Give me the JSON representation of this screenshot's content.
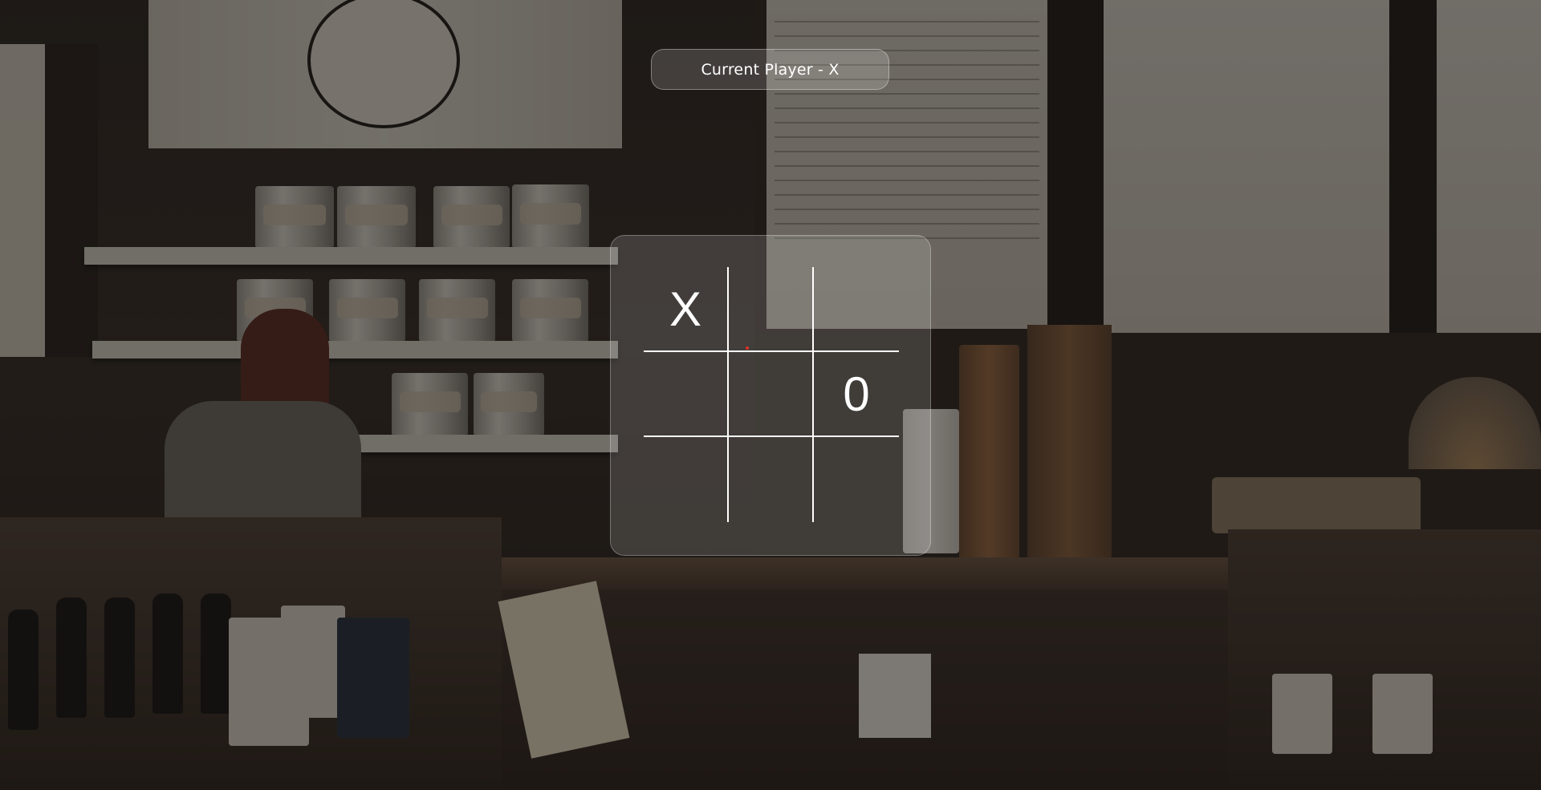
{
  "status": {
    "current_player_text": "Current Player - X"
  },
  "board": {
    "cells": [
      "X",
      "",
      "",
      "",
      "",
      "0",
      "",
      "",
      ""
    ]
  },
  "colors": {
    "ui_text": "#ffffff",
    "grid_lines": "#ffffff",
    "panel_glass": "rgba(255,255,255,0.15)",
    "cursor_dot": "#e0302a"
  },
  "background": {
    "scene": "cafe-counter-photo"
  }
}
